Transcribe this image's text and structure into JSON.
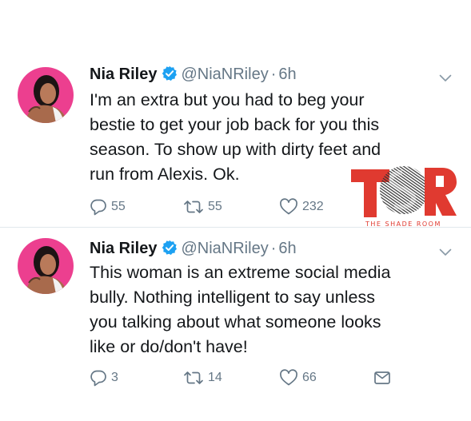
{
  "tweets": [
    {
      "name": "Nia Riley",
      "handle": "@NiaNRiley",
      "separator": "·",
      "time": "6h",
      "text": "I'm an extra but you had to beg your\nbestie to get your job back for you this\nseason. To show up with dirty feet and\nrun from Alexis. Ok.",
      "replies": "55",
      "retweets": "55",
      "likes": "232",
      "icons": [
        "verified-badge-icon",
        "chevron-down-icon",
        "reply-icon",
        "retweet-icon",
        "heart-icon"
      ]
    },
    {
      "name": "Nia Riley",
      "handle": "@NiaNRiley",
      "separator": "·",
      "time": "6h",
      "text": "This woman is an extreme social media\nbully. Nothing intelligent to say unless\nyou talking about what someone looks\nlike or do/don't have!",
      "replies": "3",
      "retweets": "14",
      "likes": "66",
      "icons": [
        "verified-badge-icon",
        "chevron-down-icon",
        "reply-icon",
        "retweet-icon",
        "heart-icon",
        "direct-message-icon"
      ]
    }
  ],
  "watermark": {
    "logo_text": "TSR",
    "caption": "THE SHADE ROOM"
  },
  "colors": {
    "text": "#14171a",
    "secondary": "#657786",
    "verified": "#1da1f2",
    "divider": "#e1e8ed",
    "watermark_red": "#e03a30",
    "avatar_bg": "#ec3f8f"
  }
}
